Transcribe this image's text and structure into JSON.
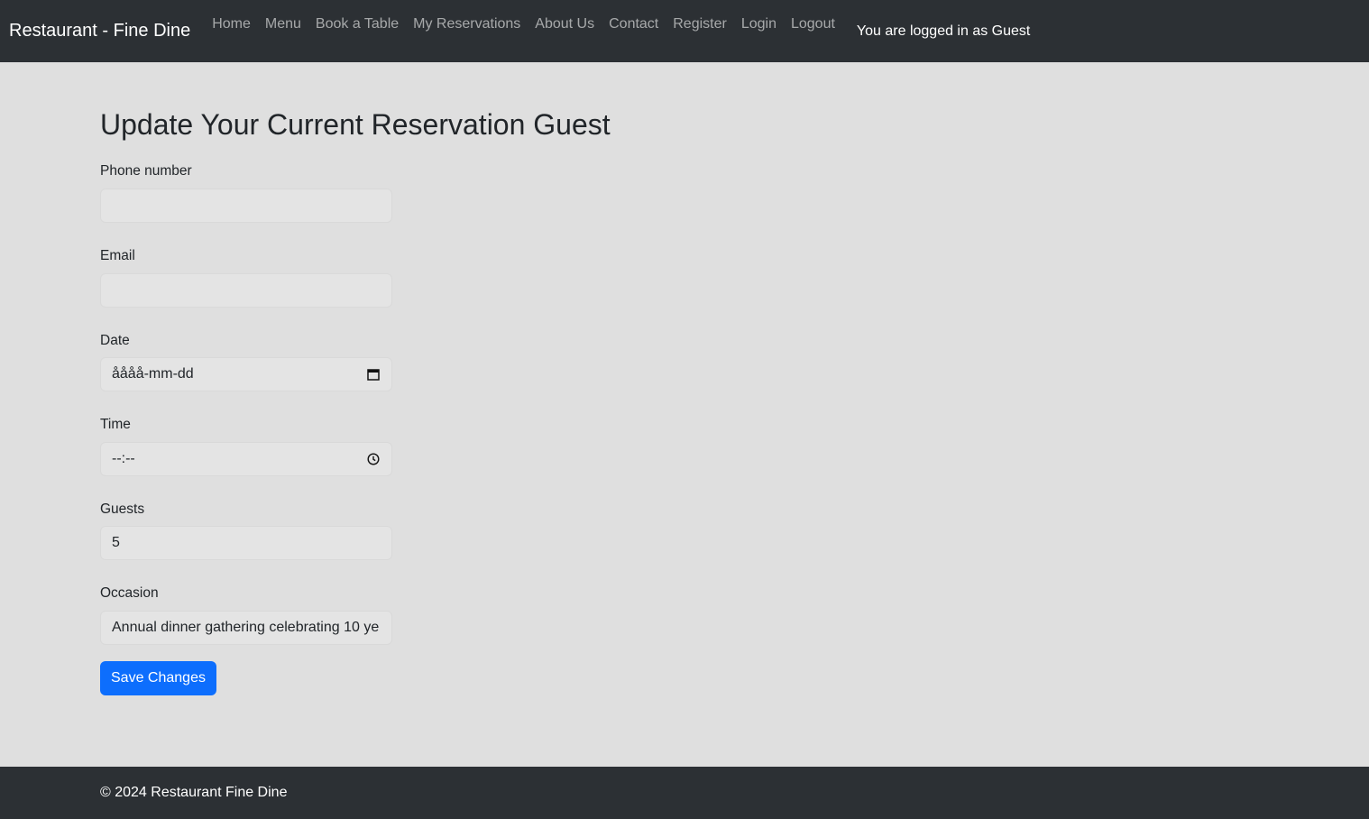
{
  "navbar": {
    "brand": "Restaurant - Fine Dine",
    "links": [
      "Home",
      "Menu",
      "Book a Table",
      "My Reservations",
      "About Us",
      "Contact",
      "Register",
      "Login",
      "Logout"
    ],
    "status": "You are logged in as Guest"
  },
  "main": {
    "title": "Update Your Current Reservation Guest",
    "fields": {
      "phone": {
        "label": "Phone number",
        "value": ""
      },
      "email": {
        "label": "Email",
        "value": ""
      },
      "date": {
        "label": "Date",
        "value": "åååå-mm-dd",
        "icon": "calendar-icon"
      },
      "time": {
        "label": "Time",
        "value": "--:--",
        "icon": "clock-icon"
      },
      "guests": {
        "label": "Guests",
        "value": "5"
      },
      "occasion": {
        "label": "Occasion",
        "value": "Annual dinner gathering celebrating 10 ye"
      }
    },
    "save_label": "Save Changes"
  },
  "footer": {
    "text": "© 2024 Restaurant Fine Dine"
  },
  "colors": {
    "navbar_bg": "#2c3034",
    "page_bg": "#dfdfdf",
    "primary": "#0d6efd"
  }
}
